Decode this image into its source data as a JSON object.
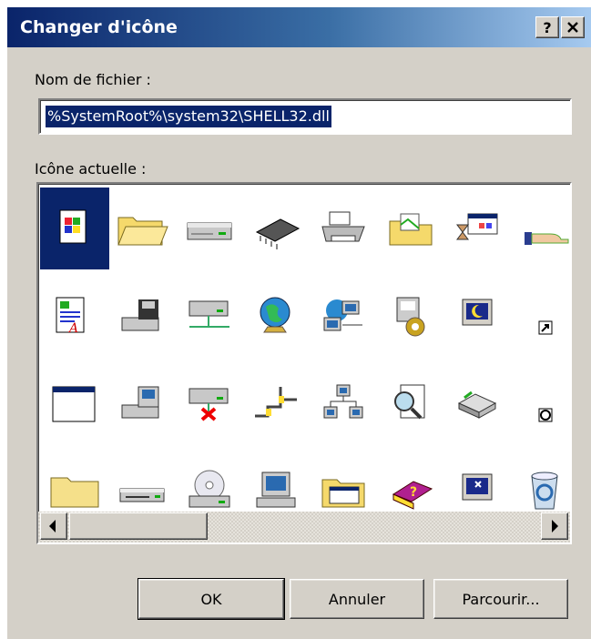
{
  "dialog": {
    "title": "Changer d'icône",
    "help_label": "?",
    "close_label": "✕"
  },
  "filename": {
    "label": "Nom de fichier :",
    "value": "%SystemRoot%\\system32\\SHELL32.dll"
  },
  "icons": {
    "label": "Icône actuelle :",
    "selected_index": 0,
    "items": [
      "windows-document-icon",
      "folder-open-icon",
      "drive-icon",
      "chip-icon",
      "printer-icon",
      "folder-docs-icon",
      "hourglass-window-icon",
      "sharing-hand-icon",
      "text-document-icon",
      "computer-floppy-icon",
      "network-drive-icon",
      "globe-icon",
      "network-computers-icon",
      "control-panel-icon",
      "monitor-moon-icon",
      "shortcut-arrow-icon",
      "window-icon",
      "computer-cd-icon",
      "disconnected-drive-icon",
      "pipe-icon",
      "network-tree-icon",
      "search-document-icon",
      "server-icon",
      "clock-overlay-icon",
      "folder-closed-icon",
      "hard-drive-icon",
      "cd-drive-icon",
      "desktop-computer-icon",
      "program-folder-icon",
      "help-book-icon",
      "monitor-icon",
      "recycle-bin-icon"
    ]
  },
  "buttons": {
    "ok": "OK",
    "cancel": "Annuler",
    "browse": "Parcourir..."
  },
  "colors": {
    "title_start": "#0a246a",
    "title_end": "#a6caf0",
    "face": "#d4d0c8",
    "selection": "#0a246a"
  }
}
